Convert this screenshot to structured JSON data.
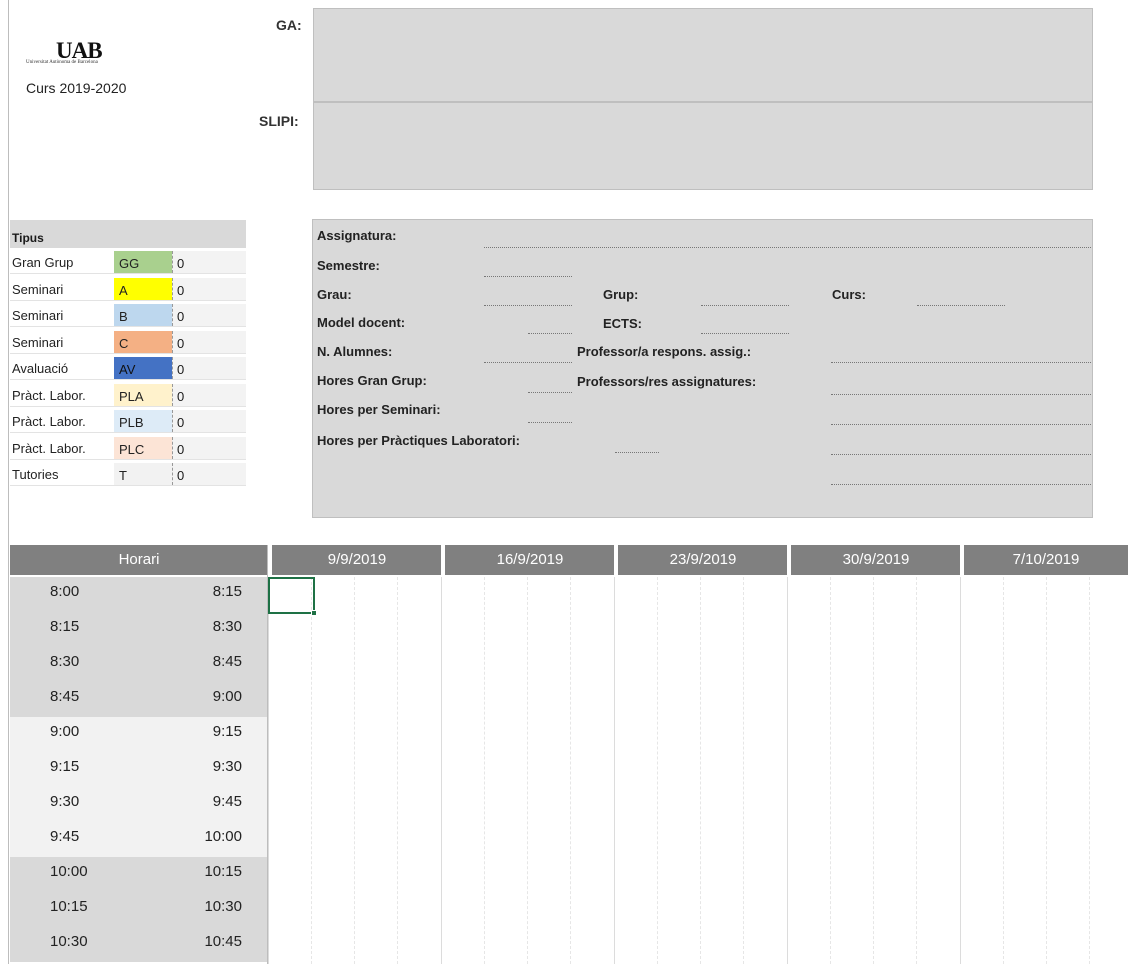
{
  "header": {
    "logo": "UAB",
    "logo_subtitle": "Universitat Autònoma de Barcelona",
    "course": "Curs 2019-2020",
    "ga_label": "GA:",
    "slipi_label": "SLIPI:"
  },
  "tipus": {
    "title": "Tipus",
    "rows": [
      {
        "name": "Gran Grup",
        "code": "GG",
        "count": "0",
        "color": "#a9d08e"
      },
      {
        "name": "Seminari",
        "code": "A",
        "count": "0",
        "color": "#ffff00"
      },
      {
        "name": "Seminari",
        "code": "B",
        "count": "0",
        "color": "#bdd7ee"
      },
      {
        "name": "Seminari",
        "code": "C",
        "count": "0",
        "color": "#f4b084"
      },
      {
        "name": "Avaluació",
        "code": "AV",
        "count": "0",
        "color": "#4472c4"
      },
      {
        "name": "Pràct. Labor.",
        "code": "PLA",
        "count": "0",
        "color": "#fff2cc"
      },
      {
        "name": "Pràct. Labor.",
        "code": "PLB",
        "count": "0",
        "color": "#ddebf7"
      },
      {
        "name": "Pràct. Labor.",
        "code": "PLC",
        "count": "0",
        "color": "#fce4d6"
      },
      {
        "name": "Tutories",
        "code": "T",
        "count": "0",
        "color": "#f2f2f2"
      }
    ]
  },
  "info": {
    "assignatura": "Assignatura:",
    "semestre": "Semestre:",
    "grau": "Grau:",
    "grup": "Grup:",
    "curs": "Curs:",
    "model_docent": "Model docent:",
    "ects": "ECTS:",
    "n_alumnes": "N. Alumnes:",
    "professor_respons": "Professor/a respons. assig.:",
    "hores_gran_grup": "Hores Gran Grup:",
    "professors_assignatures": "Professors/res assignatures:",
    "hores_seminari": "Hores per  Seminari:",
    "hores_practiques": "Hores per Pràctiques Laboratori:"
  },
  "schedule": {
    "horari_label": "Horari",
    "weeks": [
      "9/9/2019",
      "16/9/2019",
      "23/9/2019",
      "30/9/2019",
      "7/10/2019"
    ],
    "rows": [
      {
        "start": "8:00",
        "end": "8:15"
      },
      {
        "start": "8:15",
        "end": "8:30"
      },
      {
        "start": "8:30",
        "end": "8:45"
      },
      {
        "start": "8:45",
        "end": "9:00"
      },
      {
        "start": "9:00",
        "end": "9:15"
      },
      {
        "start": "9:15",
        "end": "9:30"
      },
      {
        "start": "9:30",
        "end": "9:45"
      },
      {
        "start": "9:45",
        "end": "10:00"
      },
      {
        "start": "10:00",
        "end": "10:15"
      },
      {
        "start": "10:15",
        "end": "10:30"
      },
      {
        "start": "10:30",
        "end": "10:45"
      }
    ]
  }
}
